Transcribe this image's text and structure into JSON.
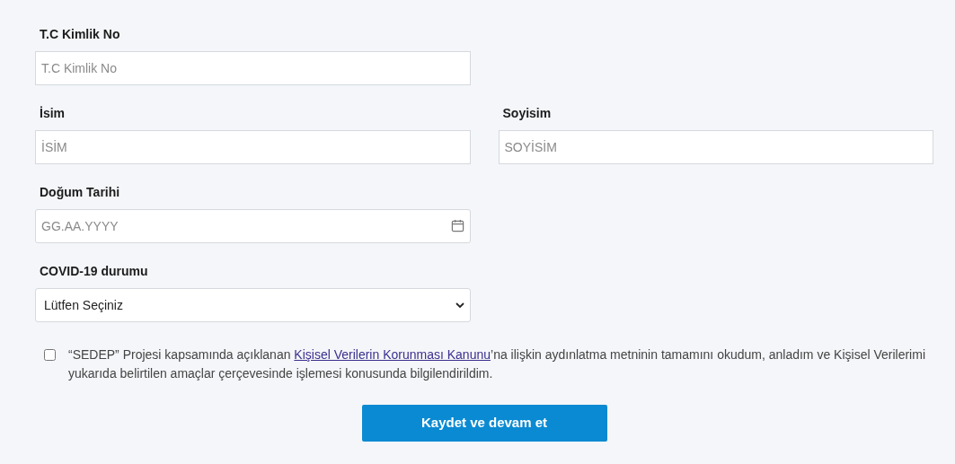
{
  "rows": [
    {
      "fields": [
        {
          "kind": "text",
          "label": "T.C Kimlik No",
          "placeholder": "T.C Kimlik No"
        }
      ]
    },
    {
      "fields": [
        {
          "kind": "text",
          "label": "İsim",
          "placeholder": "İSİM"
        },
        {
          "kind": "text",
          "label": "Soyisim",
          "placeholder": "SOYİSİM"
        }
      ]
    },
    {
      "fields": [
        {
          "kind": "date",
          "label": "Doğum Tarihi",
          "placeholder": "GG.AA.YYYY"
        }
      ]
    },
    {
      "fields": [
        {
          "kind": "select",
          "label": "COVID-19 durumu",
          "value": "Lütfen Seçiniz"
        }
      ]
    }
  ],
  "consent": {
    "checked": false,
    "before": "“SEDEP” Projesi kapsamında açıklanan ",
    "link": "Kişisel Verilerin Korunması Kanunu",
    "after": "’na ilişkin aydınlatma metninin tamamını okudum, anladım ve Kişisel Verilerimi yukarıda belirtilen amaçlar çerçevesinde işlemesi konusunda bilgilendirildim."
  },
  "submit": {
    "label": "Kaydet ve devam et"
  }
}
